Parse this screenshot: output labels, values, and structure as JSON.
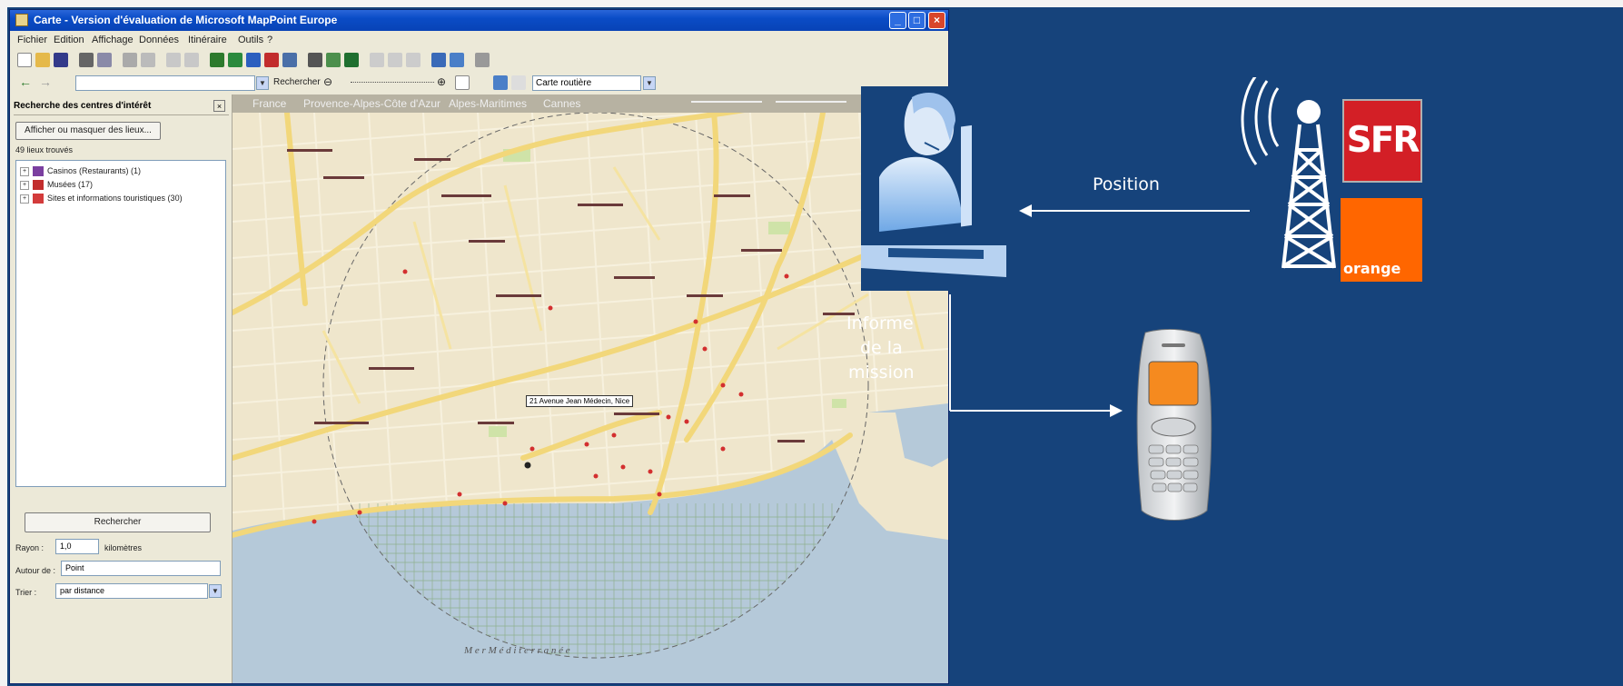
{
  "window": {
    "title": "Carte - Version d'évaluation de Microsoft MapPoint Europe",
    "controls": {
      "minimize": "_",
      "maximize": "□",
      "close": "×"
    }
  },
  "menu": [
    "Fichier",
    "Edition",
    "Affichage",
    "Données",
    "Itinéraire",
    "Outils",
    "?"
  ],
  "toolbar": {
    "search_label": "Rechercher",
    "map_style": "Carte routière",
    "nav_back": "←",
    "nav_forward": "→"
  },
  "panel": {
    "title": "Recherche des centres d'intérêt",
    "close": "×",
    "show_button": "Afficher ou masquer des lieux...",
    "count_text": "49 lieux trouvés",
    "items": [
      {
        "label": "Casinos (Restaurants) (1)",
        "expander": "+",
        "icon_color": "#7b3fa0"
      },
      {
        "label": "Musées (17)",
        "expander": "+",
        "icon_color": "#c22d2d"
      },
      {
        "label": "Sites et informations touristiques (30)",
        "expander": "+",
        "icon_color": "#d33b3b"
      }
    ],
    "search_button": "Rechercher",
    "radius_label": "Rayon :",
    "radius_value": "1,0",
    "radius_unit": "kilomètres",
    "around_label": "Autour de :",
    "around_value": "Point",
    "sort_label": "Trier :",
    "sort_value": "par distance"
  },
  "map": {
    "nav_items": [
      "France",
      "Provence-Alpes-Côte d'Azur",
      "Alpes-Maritimes",
      "Cannes"
    ],
    "tooltip": "21 Avenue Jean Médecin, Nice",
    "sea_label": "M e r   M é d i t e r r a n é e"
  },
  "diagram": {
    "position_label": "Position",
    "informe_label": [
      "Informe",
      "de la",
      "mission"
    ],
    "logo_sfr": "SFR",
    "logo_orange": "orange"
  }
}
